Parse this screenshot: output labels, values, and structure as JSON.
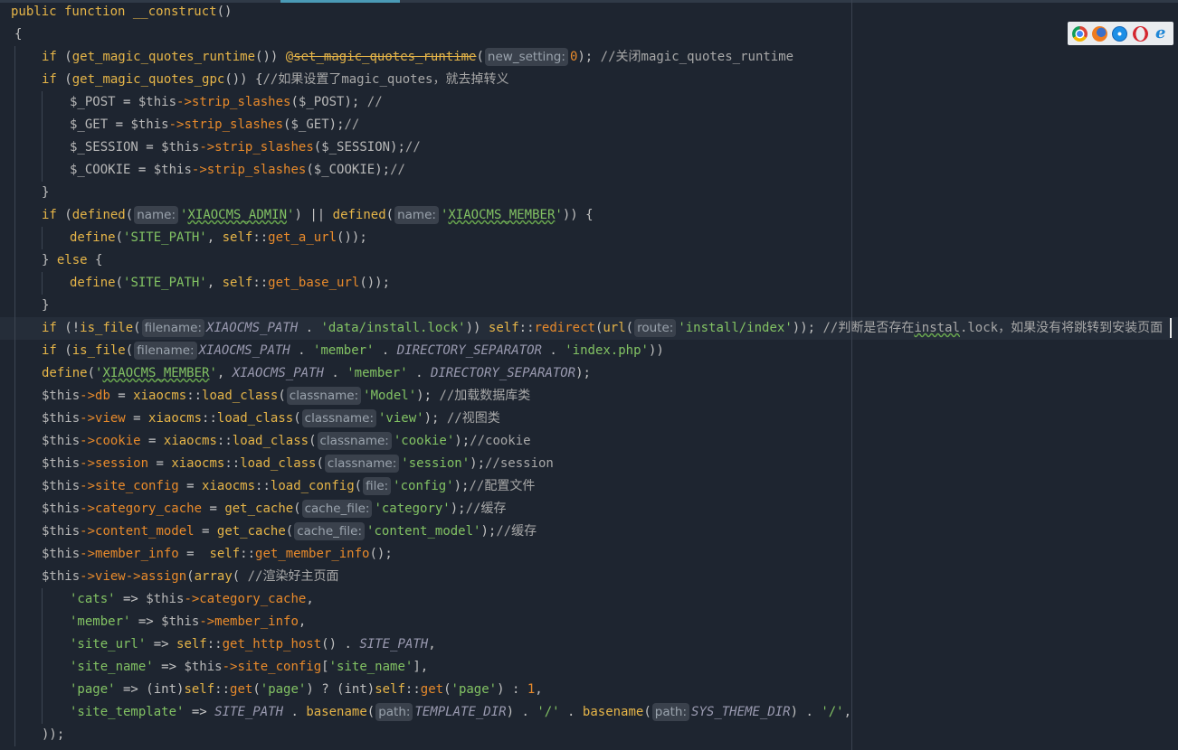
{
  "editor": {
    "lines": [
      [
        [
          "kw",
          "public function "
        ],
        [
          "fn",
          "__construct"
        ],
        [
          "pu",
          "()"
        ]
      ],
      [
        [
          "pu",
          "{"
        ]
      ],
      [
        [
          "kw",
          "if "
        ],
        [
          "pu",
          "("
        ],
        [
          "fn",
          "get_magic_quotes_runtime"
        ],
        [
          "pu",
          "()) "
        ],
        [
          "kw",
          "@"
        ],
        [
          "fn strike",
          "set_magic_quotes_runtime"
        ],
        [
          "pu",
          "("
        ],
        [
          "hint",
          "new_setting:"
        ],
        [
          "mt",
          "0"
        ],
        [
          "pu",
          ");"
        ],
        [
          "cm",
          " //关闭magic_quotes_runtime"
        ]
      ],
      [
        [
          "kw",
          "if "
        ],
        [
          "pu",
          "("
        ],
        [
          "fn",
          "get_magic_quotes_gpc"
        ],
        [
          "pu",
          "()) {"
        ],
        [
          "cm",
          "//如果设置了magic_quotes，就去掉转义"
        ]
      ],
      [
        [
          "var",
          "$_POST"
        ],
        [
          "op",
          " = "
        ],
        [
          "var",
          "$this"
        ],
        [
          "mt",
          "->strip_slashes"
        ],
        [
          "pu",
          "("
        ],
        [
          "var",
          "$_POST"
        ],
        [
          "pu",
          ");"
        ],
        [
          "cm",
          " //"
        ]
      ],
      [
        [
          "var",
          "$_GET"
        ],
        [
          "op",
          " = "
        ],
        [
          "var",
          "$this"
        ],
        [
          "mt",
          "->strip_slashes"
        ],
        [
          "pu",
          "("
        ],
        [
          "var",
          "$_GET"
        ],
        [
          "pu",
          ");"
        ],
        [
          "cm",
          "//"
        ]
      ],
      [
        [
          "var",
          "$_SESSION"
        ],
        [
          "op",
          " = "
        ],
        [
          "var",
          "$this"
        ],
        [
          "mt",
          "->strip_slashes"
        ],
        [
          "pu",
          "("
        ],
        [
          "var",
          "$_SESSION"
        ],
        [
          "pu",
          ");"
        ],
        [
          "cm",
          "//"
        ]
      ],
      [
        [
          "var",
          "$_COOKIE"
        ],
        [
          "op",
          " = "
        ],
        [
          "var",
          "$this"
        ],
        [
          "mt",
          "->strip_slashes"
        ],
        [
          "pu",
          "("
        ],
        [
          "var",
          "$_COOKIE"
        ],
        [
          "pu",
          ");"
        ],
        [
          "cm",
          "//"
        ]
      ],
      [
        [
          "pu",
          "}"
        ]
      ],
      [
        [
          "kw",
          "if "
        ],
        [
          "pu",
          "("
        ],
        [
          "fn",
          "defined"
        ],
        [
          "pu",
          "("
        ],
        [
          "hint",
          "name:"
        ],
        [
          "str",
          "'"
        ],
        [
          "str wavy",
          "XIAOCMS_ADMIN"
        ],
        [
          "str",
          "'"
        ],
        [
          "pu",
          ") || "
        ],
        [
          "fn",
          "defined"
        ],
        [
          "pu",
          "("
        ],
        [
          "hint",
          "name:"
        ],
        [
          "str",
          "'"
        ],
        [
          "str wavy",
          "XIAOCMS_MEMBER"
        ],
        [
          "str",
          "'"
        ],
        [
          "pu",
          ")) {"
        ]
      ],
      [
        [
          "fn",
          "define"
        ],
        [
          "pu",
          "("
        ],
        [
          "str",
          "'SITE_PATH'"
        ],
        [
          "pu",
          ", "
        ],
        [
          "kw",
          "self"
        ],
        [
          "pu",
          "::"
        ],
        [
          "mt",
          "get_a_url"
        ],
        [
          "pu",
          "());"
        ]
      ],
      [
        [
          "pu",
          "} "
        ],
        [
          "kw",
          "else"
        ],
        [
          "pu",
          " {"
        ]
      ],
      [
        [
          "fn",
          "define"
        ],
        [
          "pu",
          "("
        ],
        [
          "str",
          "'SITE_PATH'"
        ],
        [
          "pu",
          ", "
        ],
        [
          "kw",
          "self"
        ],
        [
          "pu",
          "::"
        ],
        [
          "mt",
          "get_base_url"
        ],
        [
          "pu",
          "());"
        ]
      ],
      [
        [
          "pu",
          "}"
        ]
      ],
      [
        [
          "kw",
          "if "
        ],
        [
          "pu",
          "(!"
        ],
        [
          "fn",
          "is_file"
        ],
        [
          "pu",
          "("
        ],
        [
          "hint",
          "filename:"
        ],
        [
          "con",
          "XIAOCMS_PATH"
        ],
        [
          "pu",
          " . "
        ],
        [
          "str",
          "'data/install.lock'"
        ],
        [
          "pu",
          ")) "
        ],
        [
          "kw",
          "self"
        ],
        [
          "pu",
          "::"
        ],
        [
          "mt",
          "redirect"
        ],
        [
          "pu",
          "("
        ],
        [
          "fn",
          "url"
        ],
        [
          "pu",
          "("
        ],
        [
          "hint",
          "route:"
        ],
        [
          "str",
          "'install/index'"
        ],
        [
          "pu",
          "));"
        ],
        [
          "cm",
          " //判断是否存在"
        ],
        [
          "cm wavy",
          "instal"
        ],
        [
          "cm",
          ".lock，如果没有将跳转到安装页面"
        ]
      ],
      [
        [
          "kw",
          "if "
        ],
        [
          "pu",
          "("
        ],
        [
          "fn",
          "is_file"
        ],
        [
          "pu",
          "("
        ],
        [
          "hint",
          "filename:"
        ],
        [
          "con",
          "XIAOCMS_PATH"
        ],
        [
          "pu",
          " . "
        ],
        [
          "str",
          "'member'"
        ],
        [
          "pu",
          " . "
        ],
        [
          "con",
          "DIRECTORY_SEPARATOR"
        ],
        [
          "pu",
          " . "
        ],
        [
          "str",
          "'index.php'"
        ],
        [
          "pu",
          "))"
        ]
      ],
      [
        [
          "fn",
          "define"
        ],
        [
          "pu",
          "("
        ],
        [
          "str",
          "'"
        ],
        [
          "str wavy",
          "XIAOCMS_MEMBER"
        ],
        [
          "str",
          "'"
        ],
        [
          "pu",
          ", "
        ],
        [
          "con",
          "XIAOCMS_PATH"
        ],
        [
          "pu",
          " . "
        ],
        [
          "str",
          "'member'"
        ],
        [
          "pu",
          " . "
        ],
        [
          "con",
          "DIRECTORY_SEPARATOR"
        ],
        [
          "pu",
          ");"
        ]
      ],
      [
        [
          "var",
          "$this"
        ],
        [
          "mt",
          "->db"
        ],
        [
          "op",
          " = "
        ],
        [
          "fn",
          "xiaocms"
        ],
        [
          "pu",
          "::"
        ],
        [
          "fn",
          "load_class"
        ],
        [
          "pu",
          "("
        ],
        [
          "hint",
          "classname:"
        ],
        [
          "str",
          "'Model'"
        ],
        [
          "pu",
          ");"
        ],
        [
          "cm",
          " //加载数据库类"
        ]
      ],
      [
        [
          "var",
          "$this"
        ],
        [
          "mt",
          "->view"
        ],
        [
          "op",
          " = "
        ],
        [
          "fn",
          "xiaocms"
        ],
        [
          "pu",
          "::"
        ],
        [
          "fn",
          "load_class"
        ],
        [
          "pu",
          "("
        ],
        [
          "hint",
          "classname:"
        ],
        [
          "str",
          "'view'"
        ],
        [
          "pu",
          ");"
        ],
        [
          "cm",
          " //视图类"
        ]
      ],
      [
        [
          "var",
          "$this"
        ],
        [
          "mt",
          "->cookie"
        ],
        [
          "op",
          " = "
        ],
        [
          "fn",
          "xiaocms"
        ],
        [
          "pu",
          "::"
        ],
        [
          "fn",
          "load_class"
        ],
        [
          "pu",
          "("
        ],
        [
          "hint",
          "classname:"
        ],
        [
          "str",
          "'cookie'"
        ],
        [
          "pu",
          ");"
        ],
        [
          "cm",
          "//cookie"
        ]
      ],
      [
        [
          "var",
          "$this"
        ],
        [
          "mt",
          "->session"
        ],
        [
          "op",
          " = "
        ],
        [
          "fn",
          "xiaocms"
        ],
        [
          "pu",
          "::"
        ],
        [
          "fn",
          "load_class"
        ],
        [
          "pu",
          "("
        ],
        [
          "hint",
          "classname:"
        ],
        [
          "str",
          "'session'"
        ],
        [
          "pu",
          ");"
        ],
        [
          "cm",
          "//session"
        ]
      ],
      [
        [
          "var",
          "$this"
        ],
        [
          "mt",
          "->site_config"
        ],
        [
          "op",
          " = "
        ],
        [
          "fn",
          "xiaocms"
        ],
        [
          "pu",
          "::"
        ],
        [
          "fn",
          "load_config"
        ],
        [
          "pu",
          "("
        ],
        [
          "hint",
          "file:"
        ],
        [
          "str",
          "'config'"
        ],
        [
          "pu",
          ");"
        ],
        [
          "cm",
          "//配置文件"
        ]
      ],
      [
        [
          "var",
          "$this"
        ],
        [
          "mt",
          "->category_cache"
        ],
        [
          "op",
          " = "
        ],
        [
          "fn",
          "get_cache"
        ],
        [
          "pu",
          "("
        ],
        [
          "hint",
          "cache_file:"
        ],
        [
          "str",
          "'category'"
        ],
        [
          "pu",
          ");"
        ],
        [
          "cm",
          "//缓存"
        ]
      ],
      [
        [
          "var",
          "$this"
        ],
        [
          "mt",
          "->content_model"
        ],
        [
          "op",
          " = "
        ],
        [
          "fn",
          "get_cache"
        ],
        [
          "pu",
          "("
        ],
        [
          "hint",
          "cache_file:"
        ],
        [
          "str",
          "'content_model'"
        ],
        [
          "pu",
          ");"
        ],
        [
          "cm",
          "//缓存"
        ]
      ],
      [
        [
          "var",
          "$this"
        ],
        [
          "mt",
          "->member_info"
        ],
        [
          "op",
          " =  "
        ],
        [
          "kw",
          "self"
        ],
        [
          "pu",
          "::"
        ],
        [
          "mt",
          "get_member_info"
        ],
        [
          "pu",
          "();"
        ]
      ],
      [
        [
          "var",
          "$this"
        ],
        [
          "mt",
          "->view->assign"
        ],
        [
          "pu",
          "("
        ],
        [
          "kw",
          "array"
        ],
        [
          "pu",
          "("
        ],
        [
          "cm",
          " //渲染好主页面"
        ]
      ],
      [
        [
          "str",
          "'cats'"
        ],
        [
          "op",
          " => "
        ],
        [
          "var",
          "$this"
        ],
        [
          "mt",
          "->category_cache"
        ],
        [
          "pu",
          ","
        ]
      ],
      [
        [
          "str",
          "'member'"
        ],
        [
          "op",
          " => "
        ],
        [
          "var",
          "$this"
        ],
        [
          "mt",
          "->member_info"
        ],
        [
          "pu",
          ","
        ]
      ],
      [
        [
          "str",
          "'site_url'"
        ],
        [
          "op",
          " => "
        ],
        [
          "kw",
          "self"
        ],
        [
          "pu",
          "::"
        ],
        [
          "mt",
          "get_http_host"
        ],
        [
          "pu",
          "() . "
        ],
        [
          "con",
          "SITE_PATH"
        ],
        [
          "pu",
          ","
        ]
      ],
      [
        [
          "str",
          "'site_name'"
        ],
        [
          "op",
          " => "
        ],
        [
          "var",
          "$this"
        ],
        [
          "mt",
          "->site_config"
        ],
        [
          "pu",
          "["
        ],
        [
          "str",
          "'site_name'"
        ],
        [
          "pu",
          "],"
        ]
      ],
      [
        [
          "str",
          "'page'"
        ],
        [
          "op",
          " => "
        ],
        [
          "pu",
          "(int)"
        ],
        [
          "kw",
          "self"
        ],
        [
          "pu",
          "::"
        ],
        [
          "mt",
          "get"
        ],
        [
          "pu",
          "("
        ],
        [
          "str",
          "'page'"
        ],
        [
          "pu",
          ") ? (int)"
        ],
        [
          "kw",
          "self"
        ],
        [
          "pu",
          "::"
        ],
        [
          "mt",
          "get"
        ],
        [
          "pu",
          "("
        ],
        [
          "str",
          "'page'"
        ],
        [
          "pu",
          ") : "
        ],
        [
          "mt",
          "1"
        ],
        [
          "pu",
          ","
        ]
      ],
      [
        [
          "str",
          "'site_template'"
        ],
        [
          "op",
          " => "
        ],
        [
          "con",
          "SITE_PATH"
        ],
        [
          "pu",
          " . "
        ],
        [
          "fn",
          "basename"
        ],
        [
          "pu",
          "("
        ],
        [
          "hint",
          "path:"
        ],
        [
          "con",
          "TEMPLATE_DIR"
        ],
        [
          "pu",
          ") . "
        ],
        [
          "str",
          "'/'"
        ],
        [
          "pu",
          " . "
        ],
        [
          "fn",
          "basename"
        ],
        [
          "pu",
          "("
        ],
        [
          "hint",
          "path:"
        ],
        [
          "con",
          "SYS_THEME_DIR"
        ],
        [
          "pu",
          ") . "
        ],
        [
          "str",
          "'/'"
        ],
        [
          "pu",
          ","
        ]
      ],
      [
        [
          "pu",
          "));"
        ]
      ]
    ]
  },
  "browser_icons": [
    "chrome-icon",
    "firefox-icon",
    "safari-icon",
    "opera-icon",
    "ie-icon"
  ]
}
